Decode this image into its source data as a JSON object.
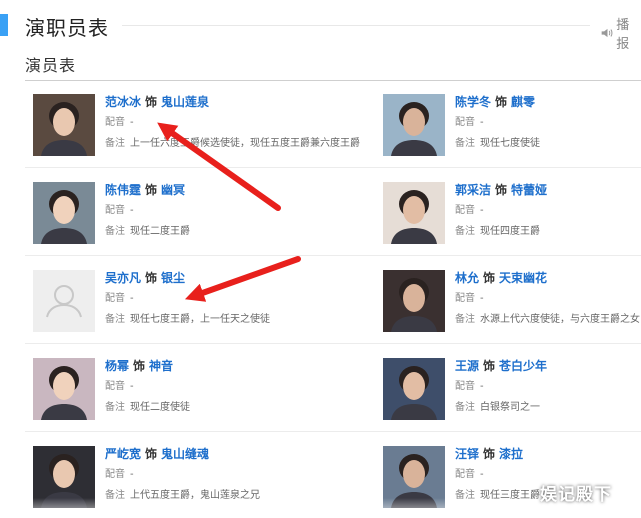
{
  "header": {
    "title": "演职员表",
    "play_label": "播报",
    "accent_color": "#3aa1f5"
  },
  "section": {
    "title": "演员表"
  },
  "labels": {
    "as": "饰",
    "dub": "配音",
    "note": "备注",
    "dash": "-"
  },
  "cast": [
    {
      "actor": "范冰冰",
      "role": "鬼山莲泉",
      "dub": "-",
      "note": "上一任六度王爵候选使徒，现任五度王爵兼六度王爵",
      "photo": "portrait-photo"
    },
    {
      "actor": "陈学冬",
      "role": "麒零",
      "dub": "-",
      "note": "现任七度使徒",
      "photo": "portrait-photo"
    },
    {
      "actor": "陈伟霆",
      "role": "幽冥",
      "dub": "-",
      "note": "现任二度王爵",
      "photo": "portrait-photo"
    },
    {
      "actor": "郭采洁",
      "role": "特蕾娅",
      "dub": "-",
      "note": "现任四度王爵",
      "photo": "portrait-photo"
    },
    {
      "actor": "吴亦凡",
      "role": "银尘",
      "dub": "-",
      "note": "现任七度王爵，上一任天之使徒",
      "photo": "placeholder"
    },
    {
      "actor": "林允",
      "role": "天束幽花",
      "dub": "-",
      "note": "水源上代六度使徒，与六度王爵之女",
      "photo": "portrait-photo"
    },
    {
      "actor": "杨幂",
      "role": "神音",
      "dub": "-",
      "note": "现任二度使徒",
      "photo": "portrait-photo"
    },
    {
      "actor": "王源",
      "role": "苍白少年",
      "dub": "-",
      "note": "白银祭司之一",
      "photo": "portrait-photo"
    },
    {
      "actor": "严屹宽",
      "role": "鬼山缝魂",
      "dub": "-",
      "note": "上代五度王爵，鬼山莲泉之兄",
      "photo": "portrait-photo"
    },
    {
      "actor": "汪铎",
      "role": "漆拉",
      "dub": "-",
      "note": "现任三度王爵",
      "photo": "portrait-photo"
    }
  ],
  "annotations": {
    "arrow_color": "#e8201c"
  },
  "watermark": "娱记殿下"
}
